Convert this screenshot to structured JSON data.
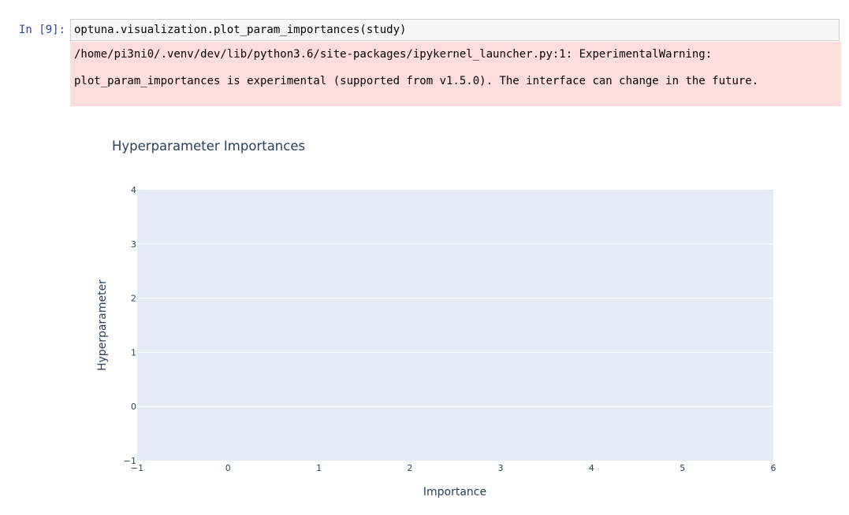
{
  "notebook": {
    "prompt": "In [9]:",
    "input_code": "optuna.visualization.plot_param_importances(study)",
    "stderr": {
      "line1": "/home/pi3ni0/.venv/dev/lib/python3.6/site-packages/ipykernel_launcher.py:1: ExperimentalWarning:",
      "line2": "plot_param_importances is experimental (supported from v1.5.0). The interface can change in the future."
    }
  },
  "colors": {
    "plot_background": "#e5ecf6",
    "gridline": "#ffffff",
    "text": "#2a3f5f",
    "stderr_background": "#ffdddd",
    "prompt": "#303f9f"
  },
  "chart_data": {
    "type": "bar",
    "orientation": "horizontal",
    "title": "Hyperparameter Importances",
    "xlabel": "Importance",
    "ylabel": "Hyperparameter",
    "xlim": [
      -1,
      6
    ],
    "ylim": [
      -1,
      4
    ],
    "x_ticks": [
      "−1",
      "0",
      "1",
      "2",
      "3",
      "4",
      "5",
      "6"
    ],
    "y_ticks": [
      "−1",
      "0",
      "1",
      "2",
      "3",
      "4"
    ],
    "grid": true,
    "categories": [],
    "values": []
  }
}
